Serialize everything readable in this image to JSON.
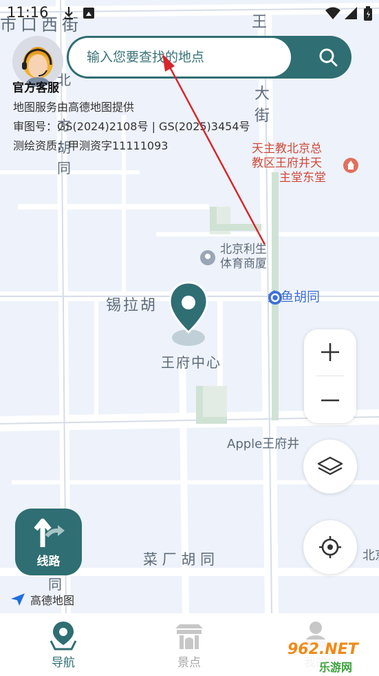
{
  "status_bar": {
    "time": "11:16"
  },
  "search": {
    "placeholder": "输入您要查找的地点"
  },
  "customer_service": {
    "label": "官方客服"
  },
  "map_info": {
    "provider": "地图服务由高德地图提供",
    "approval": "审图号：GS(2024)2108号 | GS(2025)3454号",
    "survey": "测绘资质：甲测资字11111093"
  },
  "map_labels": {
    "street_top": "市口西街",
    "street_right": "王",
    "street_right2": "大",
    "street_right3": "街",
    "lane1": "北",
    "lane2": "方",
    "lane3": "胡",
    "lane4": "同",
    "xila": "锡拉胡",
    "center": "王府中心",
    "caichang": "菜 厂 胡 同",
    "xi": "西",
    "tong": "同",
    "bei": "北京"
  },
  "pois": {
    "church": "天主教北京总教区王府井天主堂东堂",
    "church_l1": "天主教北京总",
    "church_l2": "教区王府井天",
    "church_l3": "主堂东堂",
    "sports_l1": "北京利生",
    "sports_l2": "体育商厦",
    "metro": "金鱼胡同",
    "apple": "Apple王府井"
  },
  "controls": {
    "zoom_in": "+",
    "zoom_out": "−",
    "route_label": "线路"
  },
  "amap_logo": "高德地图",
  "tabs": [
    {
      "label": "导航",
      "active": true
    },
    {
      "label": "景点",
      "active": false
    },
    {
      "label": "我的",
      "active": false
    }
  ],
  "watermark": {
    "brand": "962.NET",
    "sub": "乐游网"
  },
  "colors": {
    "accent": "#2f6e72",
    "poi_red": "#d0493a",
    "poi_blue": "#3d6fd8"
  }
}
